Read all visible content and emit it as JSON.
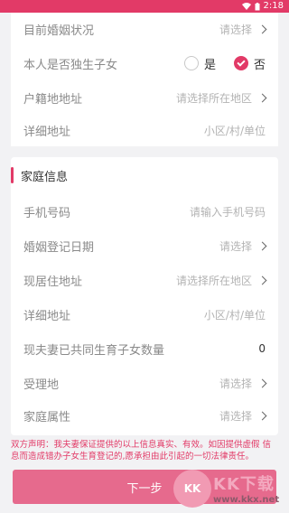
{
  "status": {
    "time": "2:18"
  },
  "colors": {
    "accent": "#e23a67",
    "button": "#e66a8d",
    "background": "#f2f2f4"
  },
  "form_top": [
    {
      "label": "目前婚姻状况",
      "value": "请选择",
      "type": "select"
    },
    {
      "label": "本人是否独生子女",
      "type": "radio",
      "options": [
        "是",
        "否"
      ],
      "selected": "否"
    },
    {
      "label": "户籍地地址",
      "value": "请选择所在地区",
      "type": "select"
    },
    {
      "label": "详细地址",
      "value": "小区/村/单位",
      "type": "input"
    }
  ],
  "family_section": {
    "title": "家庭信息",
    "rows": [
      {
        "label": "手机号码",
        "value": "请输入手机号码",
        "type": "input"
      },
      {
        "label": "婚姻登记日期",
        "value": "请选择",
        "type": "select"
      },
      {
        "label": "现居住地址",
        "value": "请选择所在地区",
        "type": "select"
      },
      {
        "label": "详细地址",
        "value": "小区/村/单位",
        "type": "input"
      },
      {
        "label": "现夫妻已共同生育子女数量",
        "value": "0",
        "type": "number"
      },
      {
        "label": "受理地",
        "value": "请选择",
        "type": "select"
      },
      {
        "label": "家庭属性",
        "value": "请选择",
        "type": "select"
      }
    ]
  },
  "notice": "双方声明：我夫妻保证提供的以上信息真实、有效。如因提供虚假 信息而造成错办子女生育登记的,愿承担由此引起的一切法律责任。",
  "next_button": "下一步",
  "watermark": {
    "badge": "KK",
    "title": "KK下载",
    "domain": "www.kkx.net"
  }
}
